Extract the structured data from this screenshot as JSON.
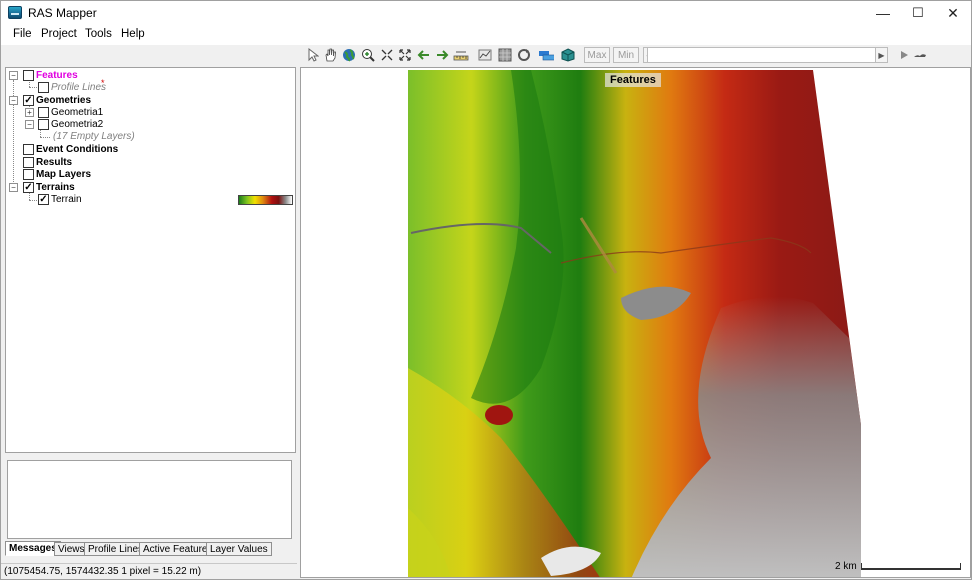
{
  "window": {
    "title": "RAS Mapper",
    "minimize": "—",
    "maximize": "☐",
    "close": "✕"
  },
  "menu": {
    "items": [
      "File",
      "Project",
      "Tools",
      "Help"
    ]
  },
  "toolbar": {
    "max_label": "Max",
    "min_label": "Min",
    "icons": [
      "select-arrow-icon",
      "pan-hand-icon",
      "globe-icon",
      "zoom-in-icon",
      "zoom-to-layer-icon",
      "full-extent-icon",
      "back-arrow-icon",
      "forward-arrow-icon",
      "ruler-icon",
      "profile-plot-icon",
      "raster-icon",
      "redraw-icon",
      "layer-stack-icon",
      "3d-cube-icon"
    ]
  },
  "tree": {
    "features": "Features",
    "profile_lines": "Profile Lines",
    "geometries": "Geometries",
    "geometria1": "Geometria1",
    "geometria2": "Geometria2",
    "empty_layers": "(17 Empty Layers)",
    "event_conditions": "Event Conditions",
    "results": "Results",
    "map_layers": "Map Layers",
    "terrains": "Terrains",
    "terrain": "Terrain"
  },
  "tabs": [
    "Messages",
    "Views",
    "Profile Lines",
    "Active Features",
    "Layer Values"
  ],
  "status": {
    "text": "(1075454.75, 1574432.35  1 pixel = 15.22 m)"
  },
  "map": {
    "overlay_label": "Features",
    "scale_label": "2 km"
  },
  "colors": {
    "features_label": "#e000e0",
    "profile_marker": "#d00000"
  }
}
